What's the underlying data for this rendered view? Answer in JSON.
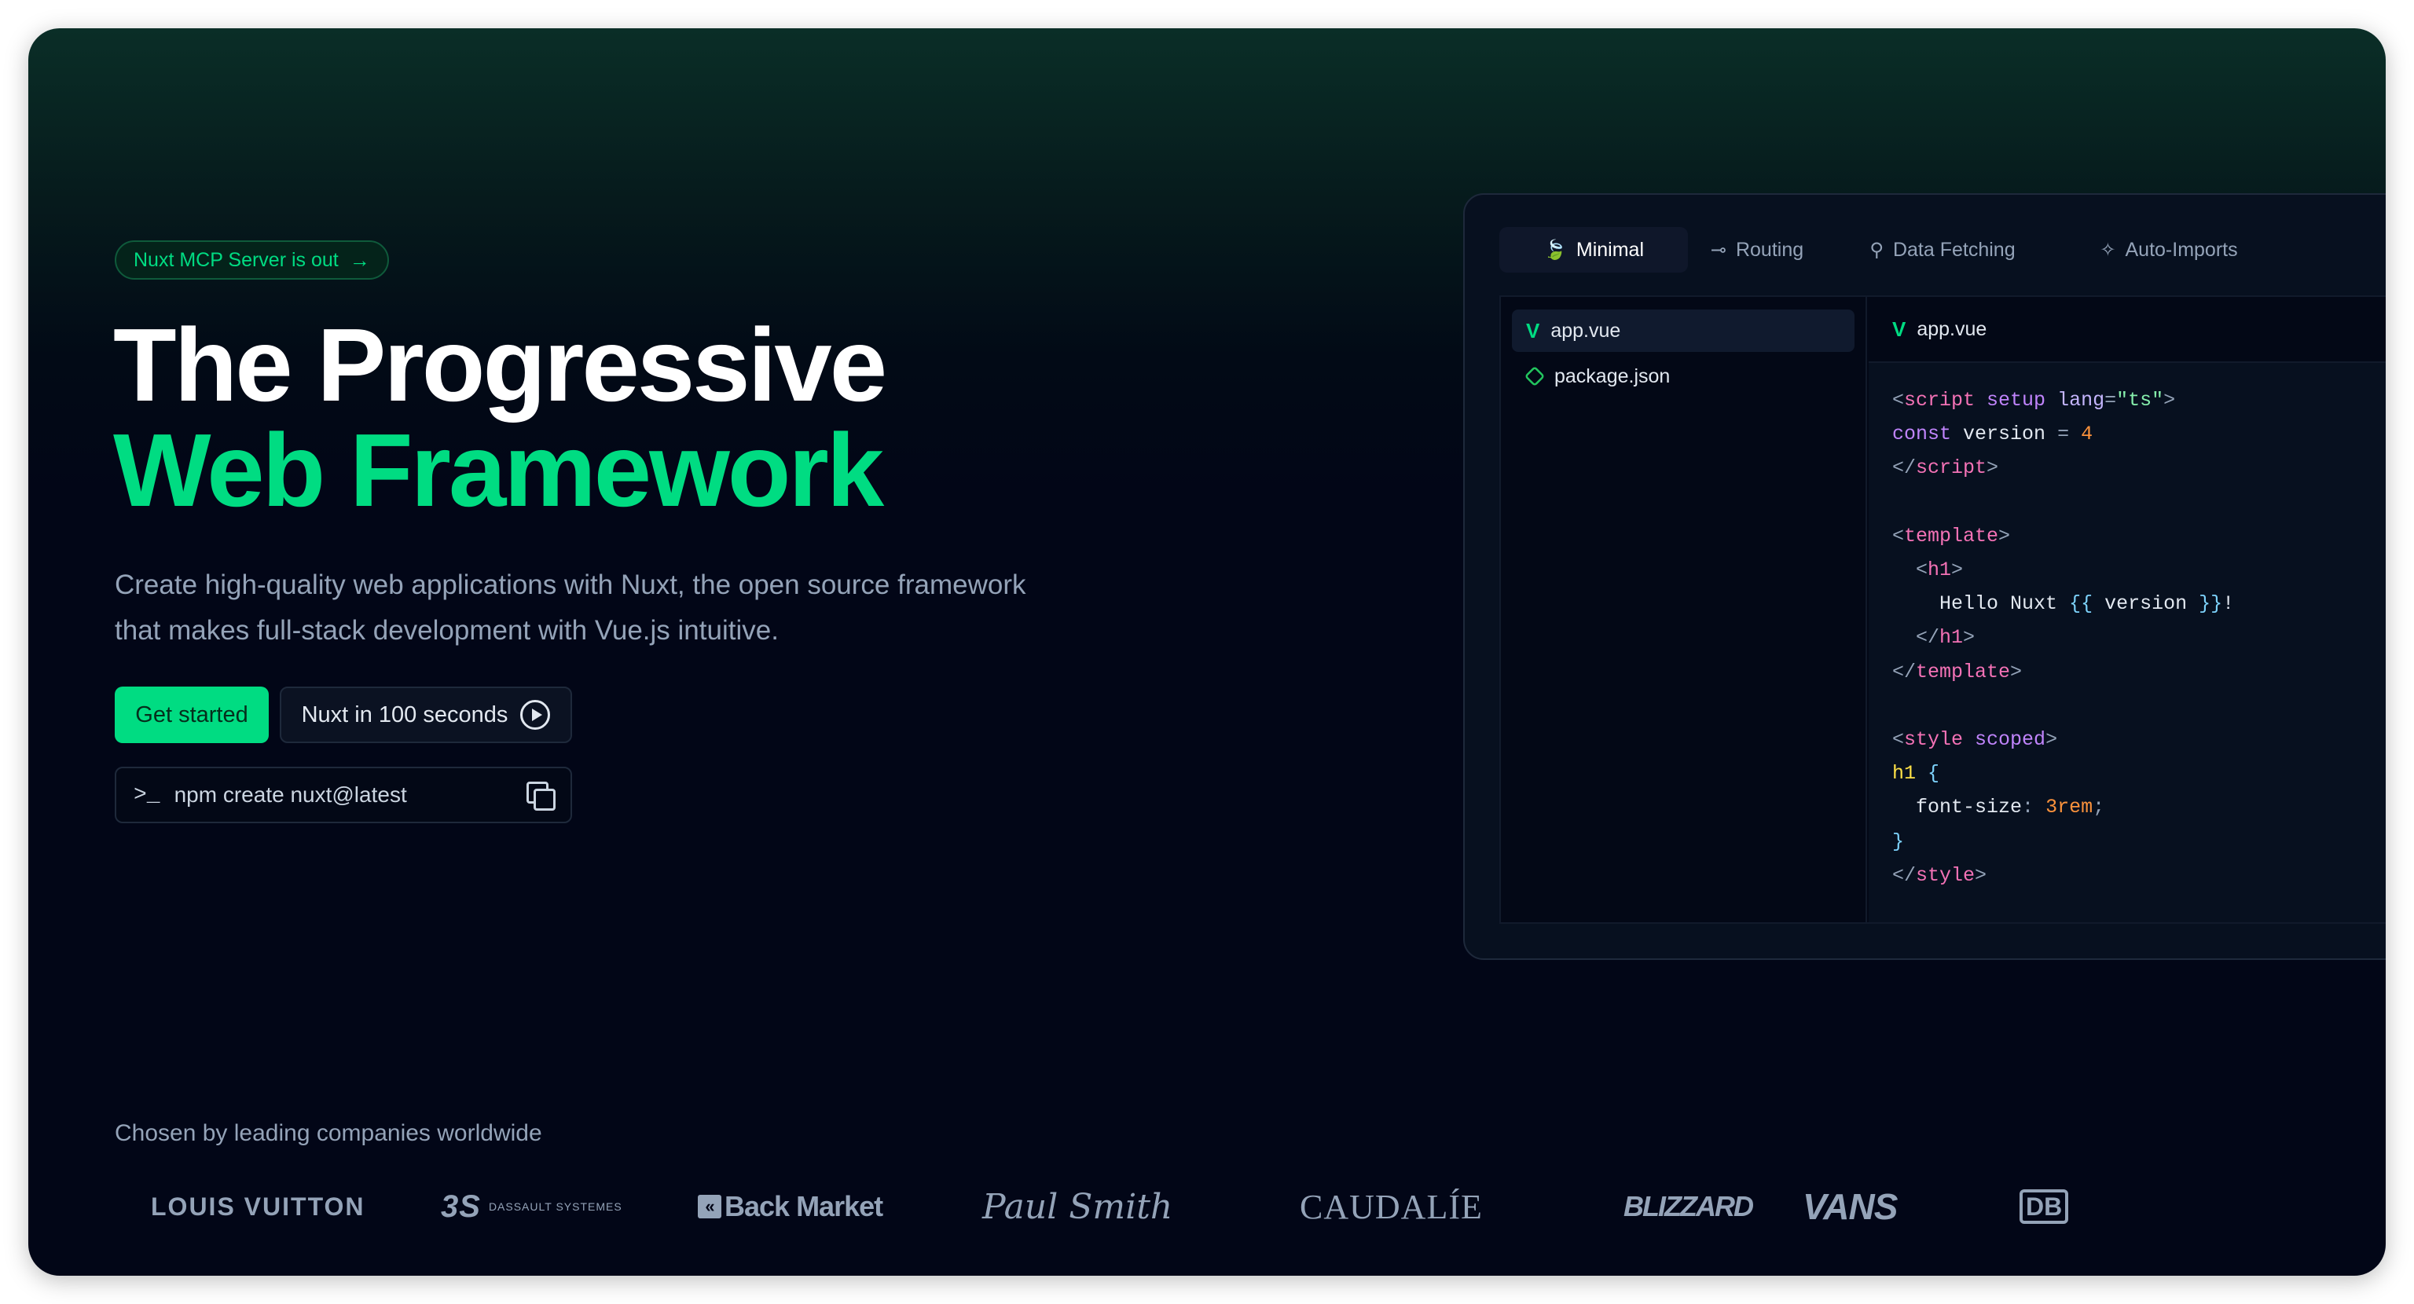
{
  "badge": {
    "label": "Nuxt MCP Server is out",
    "arrow": "→"
  },
  "hero": {
    "title_line1": "The Progressive",
    "title_line2": "Web Framework",
    "lead": "Create high-quality web applications with Nuxt, the open source framework that makes full-stack development with Vue.js intuitive."
  },
  "actions": {
    "primary_label": "Get started",
    "secondary_label": "Nuxt in 100 seconds",
    "command_prompt": ">_",
    "command": "npm create nuxt@latest"
  },
  "code_panel": {
    "tabs": [
      {
        "label": "Minimal",
        "icon": "leaf-icon",
        "glyph": "🍃"
      },
      {
        "label": "Routing",
        "icon": "signpost-icon",
        "glyph": "⊸"
      },
      {
        "label": "Data Fetching",
        "icon": "plug-icon",
        "glyph": "⚲"
      },
      {
        "label": "Auto-Imports",
        "icon": "magic-wand-icon",
        "glyph": "✧"
      }
    ],
    "files": [
      {
        "name": "app.vue",
        "icon": "vue-icon"
      },
      {
        "name": "package.json",
        "icon": "nodejs-icon"
      }
    ],
    "open_file": "app.vue"
  },
  "companies": {
    "heading": "Chosen by leading companies worldwide",
    "logos": [
      "LOUIS VUITTON",
      "DASSAULT SYSTEMES",
      "Back Market",
      "Paul Smith",
      "CAUDALÍE",
      "BLIZZARD",
      "VANS",
      "DB"
    ]
  },
  "colors": {
    "accent": "#00dc82",
    "background": "#020617",
    "muted_text": "#94a3b8"
  }
}
